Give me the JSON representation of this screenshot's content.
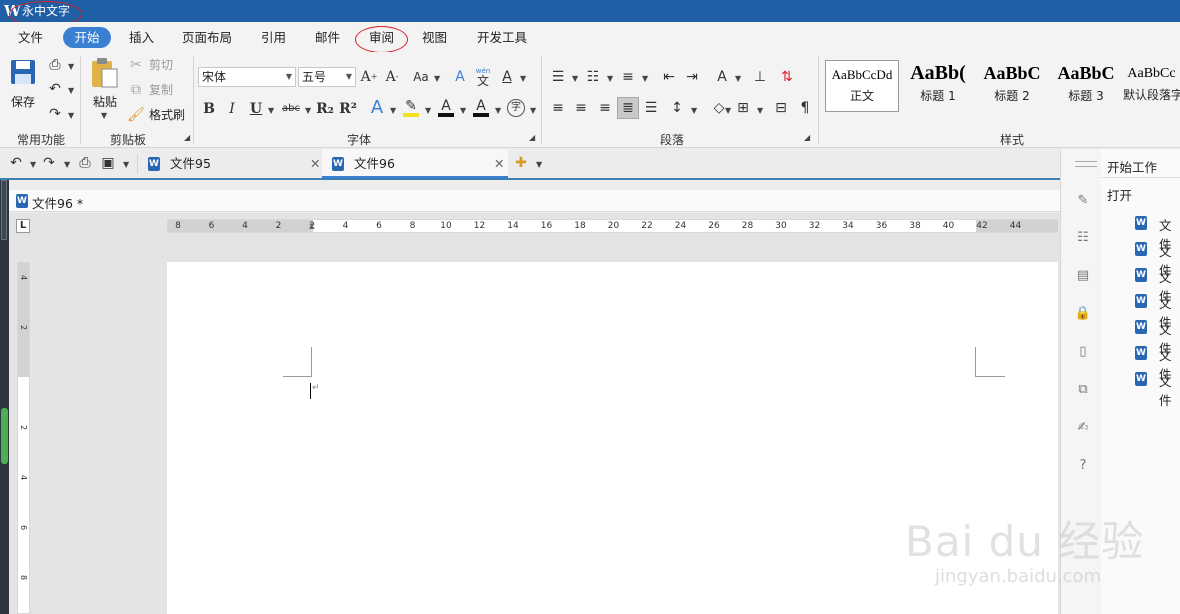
{
  "app": {
    "title": "永中文字"
  },
  "menu": {
    "items": [
      "文件",
      "开始",
      "插入",
      "页面布局",
      "引用",
      "邮件",
      "审阅",
      "视图",
      "开发工具"
    ],
    "active": "开始"
  },
  "ribbon": {
    "common": {
      "save": "保存",
      "group": "常用功能"
    },
    "clipboard": {
      "paste": "粘贴",
      "cut": "剪切",
      "copy": "复制",
      "format_painter": "格式刷",
      "group": "剪贴板"
    },
    "font": {
      "family": "宋体",
      "size": "五号",
      "group": "字体",
      "bold": "B",
      "italic": "I",
      "underline": "U",
      "strike": "abc",
      "sub": "R₂",
      "sup": "R²",
      "case": "Aa",
      "phonetic_top": "wén",
      "phonetic": "文"
    },
    "paragraph": {
      "group": "段落"
    },
    "styles": {
      "group": "样式",
      "items": [
        {
          "sample": "AaBbCcDd",
          "name": "正文"
        },
        {
          "sample": "AaBb(",
          "name": "标题 1"
        },
        {
          "sample": "AaBbC",
          "name": "标题 2"
        },
        {
          "sample": "AaBbC",
          "name": "标题 3"
        },
        {
          "sample": "AaBbCc",
          "name": "默认段落字"
        }
      ]
    }
  },
  "tabs": [
    {
      "label": "文件95"
    },
    {
      "label": "文件96"
    }
  ],
  "document": {
    "path": "文件96 *"
  },
  "ruler": {
    "h_ticks": [
      "8",
      "6",
      "4",
      "2",
      "2",
      "4",
      "6",
      "8",
      "10",
      "12",
      "14",
      "16",
      "18",
      "20",
      "22",
      "24",
      "26",
      "28",
      "30",
      "32",
      "34",
      "36",
      "38",
      "40",
      "42",
      "44"
    ],
    "v_ticks": [
      "4",
      "2",
      "2",
      "4",
      "6",
      "8"
    ]
  },
  "panel": {
    "title": "开始工作",
    "open": "打开",
    "files": [
      "文件",
      "文件",
      "文件",
      "文件",
      "文件",
      "文件",
      "文件"
    ]
  },
  "watermark": {
    "brand": "Bai  du 经验",
    "url": "jingyan.baidu.com"
  },
  "colors": {
    "title_bar": "#1f5fa6",
    "accent": "#3b7fd3",
    "annotation": "#d9202a"
  }
}
